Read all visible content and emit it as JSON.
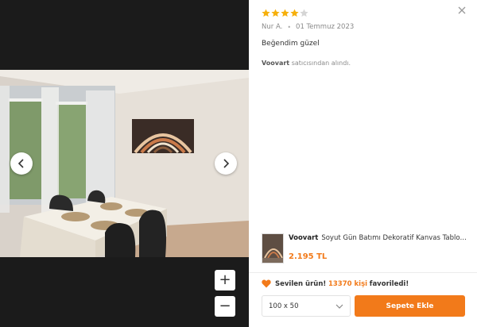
{
  "review": {
    "rating": 4,
    "max_rating": 5,
    "author": "Nur A.",
    "date": "01 Temmuz 2023",
    "text": "Beğendim güzel",
    "seller_name": "Voovart",
    "seller_suffix": "satıcısından alındı."
  },
  "product": {
    "brand": "Voovart",
    "title": "Soyut Gün Batımı Dekoratif Kanvas Tablo - Vo...",
    "price": "2.195 TL"
  },
  "favorites": {
    "prefix": "Sevilen ürün!",
    "count": "13370 kişi",
    "suffix": "favoriledi!"
  },
  "size_select": {
    "value": "100 x 50"
  },
  "cart_button": {
    "label": "Sepete Ekle"
  },
  "zoom": {
    "in_label": "+",
    "out_label": "−"
  },
  "colors": {
    "accent": "#f27a1a",
    "star": "#f6b00c",
    "star_empty": "#d5d5d5",
    "viewer_bg": "#1b1b1b"
  },
  "icons": [
    "close-icon",
    "chevron-left-icon",
    "chevron-right-icon",
    "star-icon",
    "heart-icon",
    "chevron-down-icon"
  ]
}
